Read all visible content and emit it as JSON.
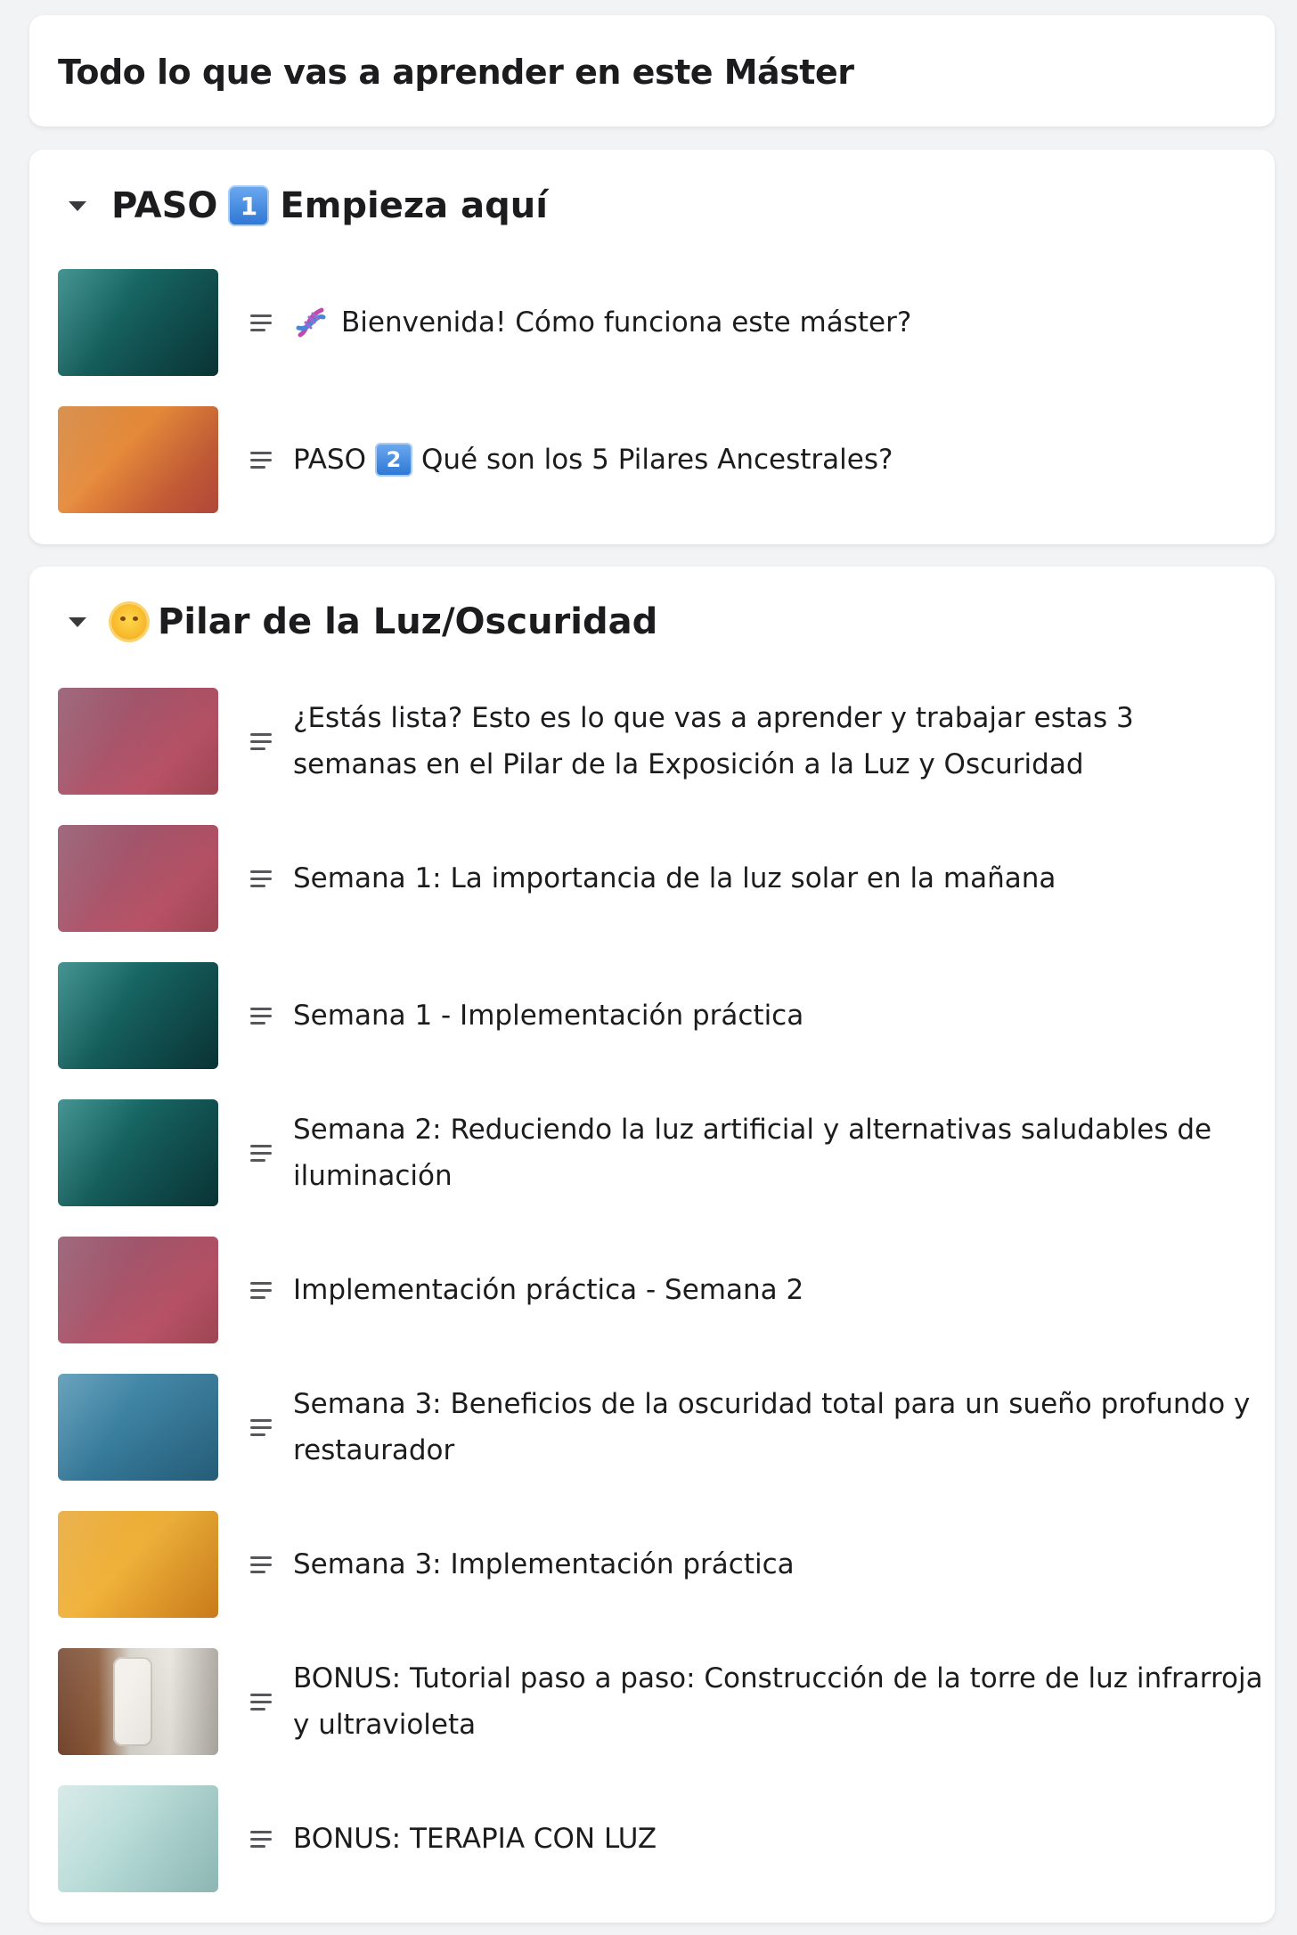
{
  "header": {
    "title": "Todo lo que vas a aprender en este Máster"
  },
  "sections": [
    {
      "title_prefix": "PASO",
      "badge": "1",
      "title_rest": "Empieza aquí",
      "items": [
        {
          "title": "Bienvenida! Cómo funciona este máster?",
          "icon": "dna-icon"
        },
        {
          "title_prefix": "PASO",
          "badge": "2",
          "title_rest": "Qué son los 5 Pilares Ancestrales?"
        }
      ]
    },
    {
      "icon": "sun-face-icon",
      "title": "Pilar de la Luz/Oscuridad",
      "items": [
        {
          "title": "¿Estás lista? Esto es lo que vas a aprender y trabajar estas 3 semanas en el Pilar de la Exposición a la Luz y Oscuridad"
        },
        {
          "title": "Semana 1: La importancia de la luz solar en la mañana"
        },
        {
          "title": "Semana 1 - Implementación práctica"
        },
        {
          "title": "Semana 2: Reduciendo la luz artificial y alternativas saludables de iluminación"
        },
        {
          "title": "Implementación práctica - Semana 2"
        },
        {
          "title": "Semana 3: Beneficios de la oscuridad total para un sueño profundo y restaurador"
        },
        {
          "title": "Semana 3: Implementación práctica"
        },
        {
          "title": "BONUS: Tutorial paso a paso: Construcción de la torre de luz infrarroja y ultravioleta"
        },
        {
          "title": "BONUS: TERAPIA CON LUZ"
        }
      ]
    }
  ]
}
